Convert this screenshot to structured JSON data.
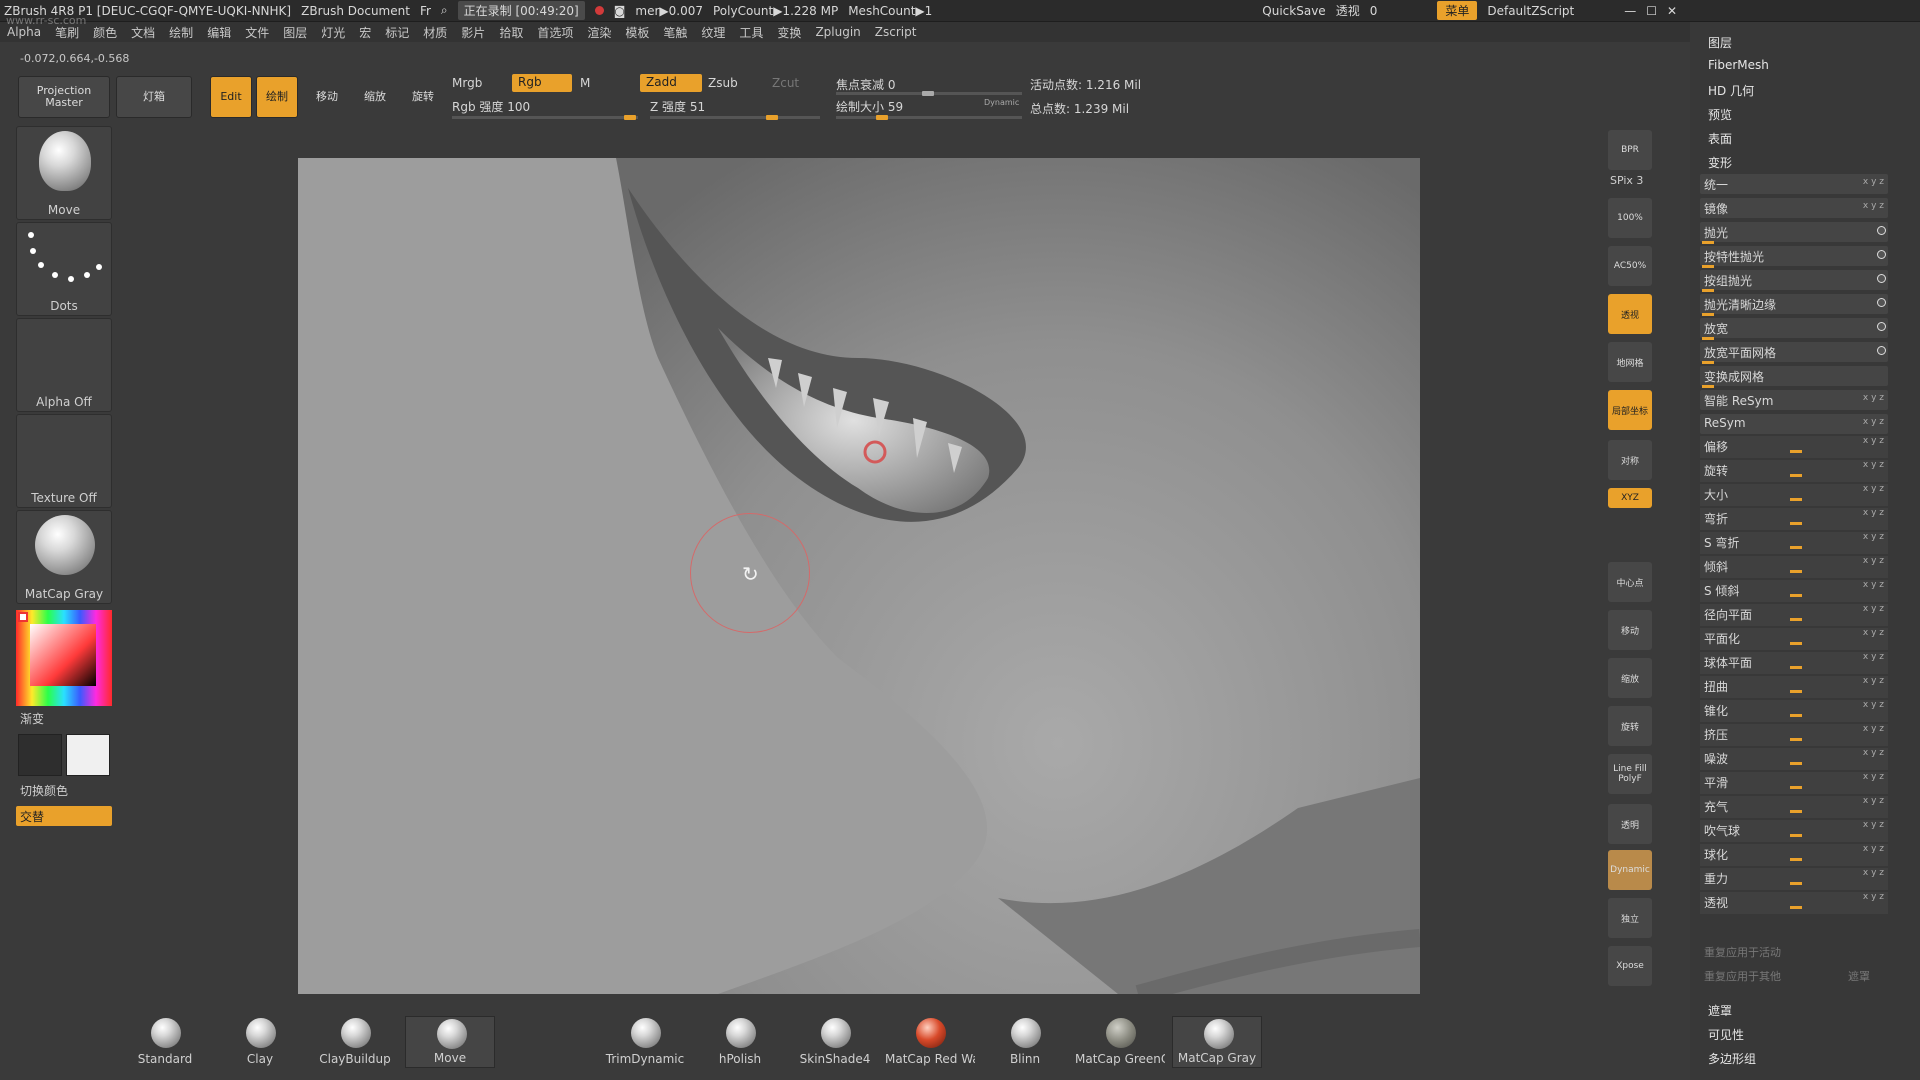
{
  "titlebar": {
    "app": "ZBrush 4R8 P1 [DEUC-CGQF-QMYE-UQKI-NNHK]",
    "document": "ZBrush Document",
    "fr": "Fr",
    "recording": "正在录制 [00:49:20]",
    "mem": "mer▶0.007",
    "polycount": "PolyCount▶1.228 MP",
    "meshcount": "MeshCount▶1",
    "quicksave": "QuickSave",
    "perspective_label": "透视",
    "perspective_value": "0",
    "menu_button": "菜单",
    "default_script": "DefaultZScript"
  },
  "menubar": [
    "Alpha",
    "笔刷",
    "颜色",
    "文档",
    "绘制",
    "编辑",
    "文件",
    "图层",
    "灯光",
    "宏",
    "标记",
    "材质",
    "影片",
    "拾取",
    "首选项",
    "渲染",
    "模板",
    "笔触",
    "纹理",
    "工具",
    "变换",
    "Zplugin",
    "Zscript"
  ],
  "coords": "-0.072,0.664,-0.568",
  "topshelf": {
    "projection_master": "Projection Master",
    "lightbox": "灯箱",
    "edit": "Edit",
    "draw": "绘制",
    "move": "移动",
    "scale": "缩放",
    "rotate": "旋转",
    "mrgb": "Mrgb",
    "rgb": "Rgb",
    "m": "M",
    "rgb_intensity": "Rgb 强度 100",
    "zadd": "Zadd",
    "zsub": "Zsub",
    "zcut": "Zcut",
    "z_intensity": "Z 强度 51",
    "focal_shift": "焦点衰减 0",
    "draw_size": "绘制大小 59",
    "dynamic": "Dynamic",
    "active_points": "活动点数: 1.216 Mil",
    "total_points": "总点数: 1.239 Mil"
  },
  "leftpanel": {
    "brush": "Move",
    "stroke": "Dots",
    "alpha": "Alpha Off",
    "texture": "Texture Off",
    "material": "MatCap Gray",
    "gradient": "渐变",
    "switch_color": "切换颜色",
    "alternate": "交替"
  },
  "righttoolbar": {
    "bpr": "BPR",
    "spix": "SPix 3",
    "zoom100": "100%",
    "ac50": "AC50%",
    "persp": "透视",
    "floor": "地网格",
    "local": "局部坐标",
    "symmetry": "对称",
    "xyz": "XYZ",
    "center": "中心点",
    "move": "移动",
    "zoom": "缩放",
    "rotate": "旋转",
    "linefill": "Line Fill",
    "polyf": "PolyF",
    "transp": "透明",
    "dynamic": "Dynamic",
    "solo": "独立",
    "xpose": "Xpose"
  },
  "rightpanel": {
    "headers": [
      "图层",
      "FiberMesh",
      "HD 几何",
      "预览",
      "表面",
      "变形"
    ],
    "items": [
      {
        "label": "统一",
        "radio": false
      },
      {
        "label": "镜像",
        "radio": false
      },
      {
        "label": "抛光",
        "radio": true
      },
      {
        "label": "按特性抛光",
        "radio": true
      },
      {
        "label": "按组抛光",
        "radio": true
      },
      {
        "label": "抛光清晰边缘",
        "radio": true
      },
      {
        "label": "放宽",
        "radio": true
      },
      {
        "label": "放宽平面网格",
        "radio": true
      },
      {
        "label": "变换成网格",
        "radio": false
      },
      {
        "label": "智能 ReSym",
        "radio": false
      },
      {
        "label": "ReSym",
        "radio": false
      }
    ],
    "sliders": [
      "偏移",
      "旋转",
      "大小",
      "弯折",
      "S 弯折",
      "倾斜",
      "S 倾斜",
      "径向平面",
      "平面化",
      "球体平面",
      "扭曲",
      "锥化",
      "挤压",
      "噪波",
      "平滑",
      "充气",
      "吹气球",
      "球化",
      "重力",
      "透视"
    ],
    "axis_mark": "x y z",
    "repeat_active": "重复应用于活动",
    "repeat_other": "重复应用于其他",
    "mask_btn": "遮罩",
    "footer": [
      "遮罩",
      "可见性",
      "多边形组"
    ]
  },
  "bottomshelf": [
    "Standard",
    "Clay",
    "ClayBuildup",
    "Move",
    "TrimDynamic",
    "hPolish",
    "SkinShade4",
    "MatCap Red Wax",
    "Blinn",
    "MatCap GreenClay",
    "MatCap Gray"
  ],
  "watermark": "www.rr-sc.com"
}
